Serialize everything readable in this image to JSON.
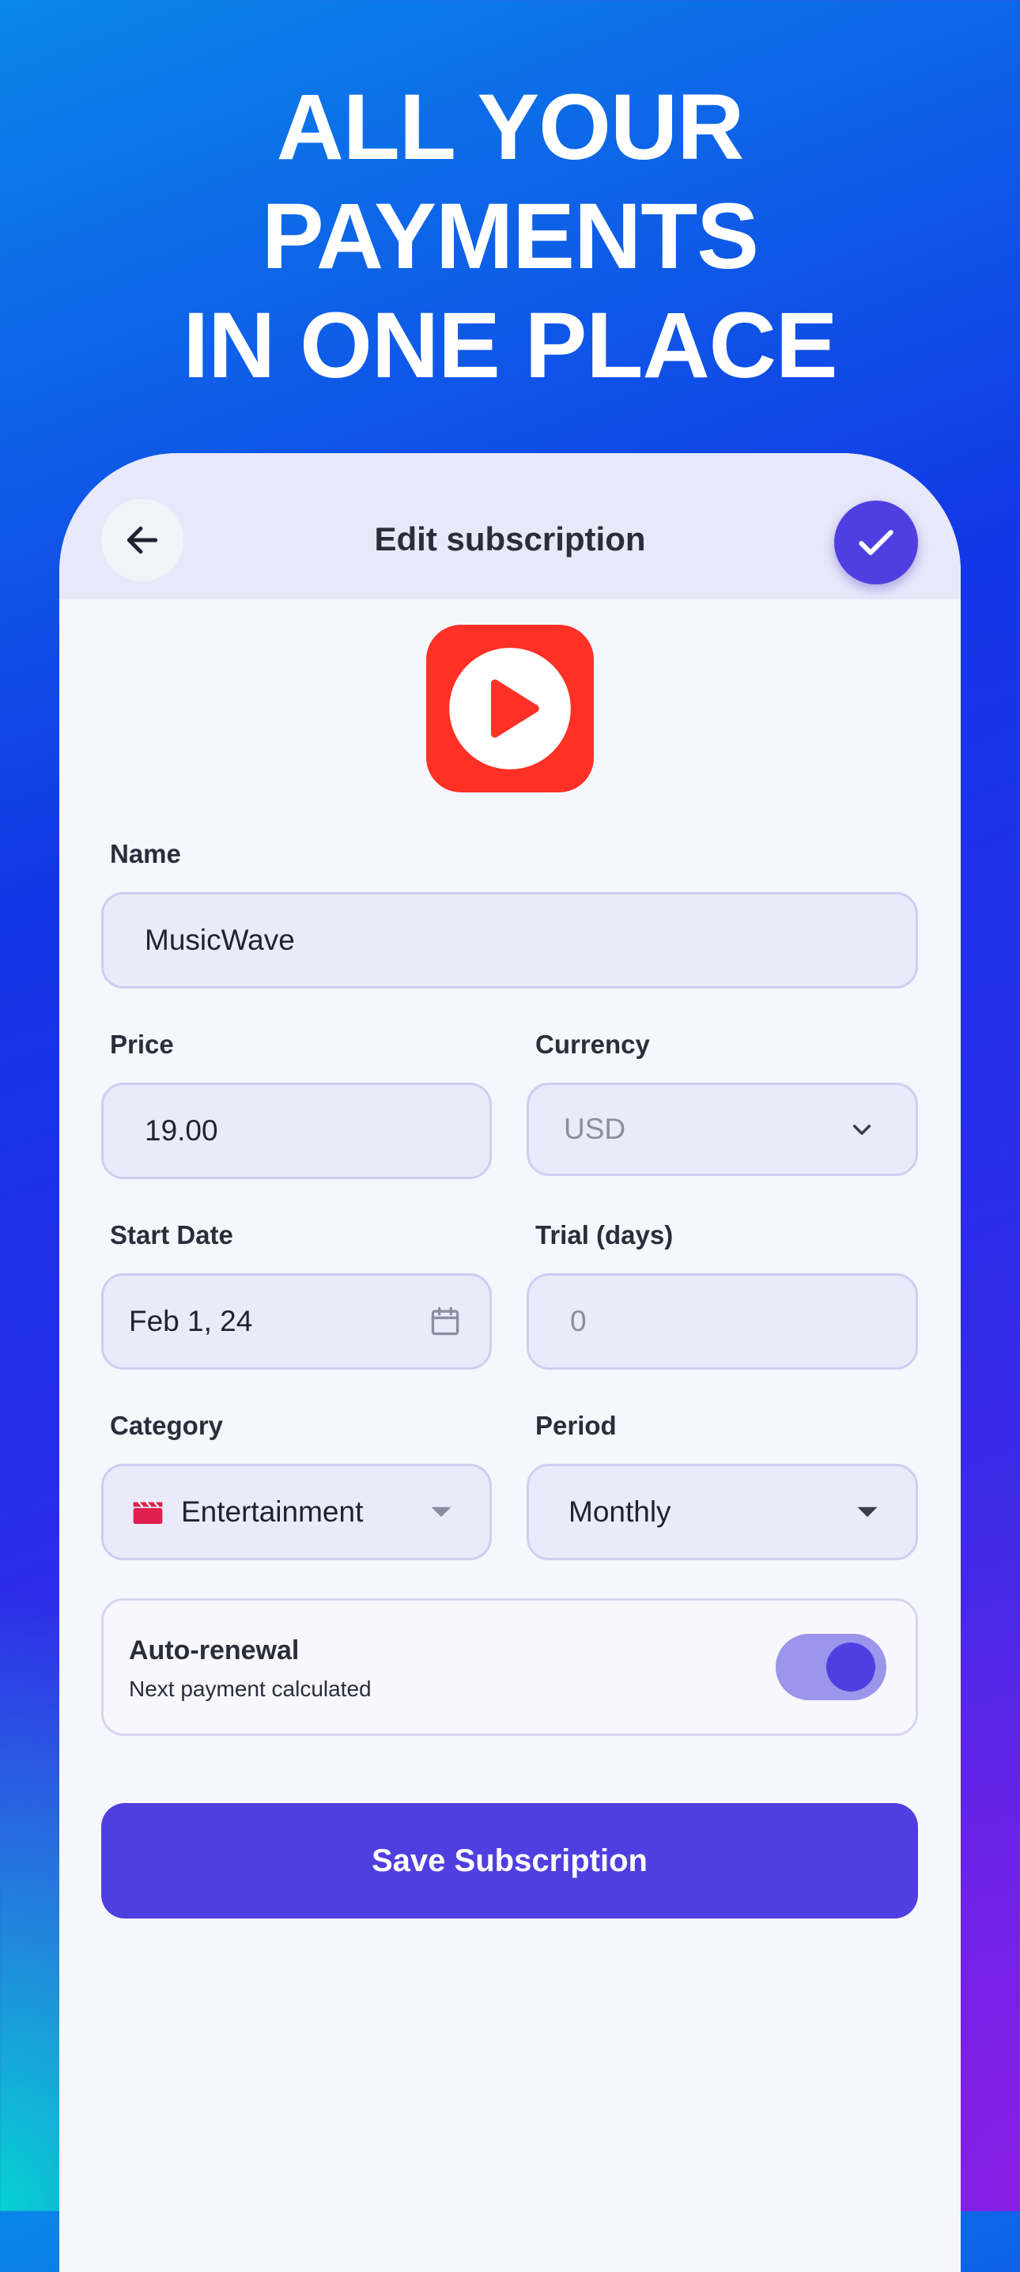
{
  "headline": {
    "line1": "ALL YOUR",
    "line2": "PAYMENTS",
    "line3": "IN ONE PLACE"
  },
  "header": {
    "title": "Edit subscription",
    "back_icon": "arrow-left-icon",
    "confirm_icon": "checkmark-icon"
  },
  "app": {
    "icon": "play-icon",
    "icon_color": "#ff3026"
  },
  "form": {
    "name_label": "Name",
    "name_value": "MusicWave",
    "price_label": "Price",
    "price_value": "19.00",
    "currency_label": "Currency",
    "currency_value": "USD",
    "start_date_label": "Start Date",
    "start_date_value": "Feb 1, 24",
    "trial_label": "Trial (days)",
    "trial_placeholder": "0",
    "category_label": "Category",
    "category_value": "Entertainment",
    "category_icon": "clapperboard-icon",
    "period_label": "Period",
    "period_value": "Monthly"
  },
  "auto_renewal": {
    "title": "Auto-renewal",
    "subtitle": "Next payment calculated",
    "enabled": true
  },
  "save_label": "Save Subscription",
  "colors": {
    "accent": "#4f3fe0",
    "field_bg": "#ebeafb",
    "card_bg": "#f6f7fd"
  }
}
